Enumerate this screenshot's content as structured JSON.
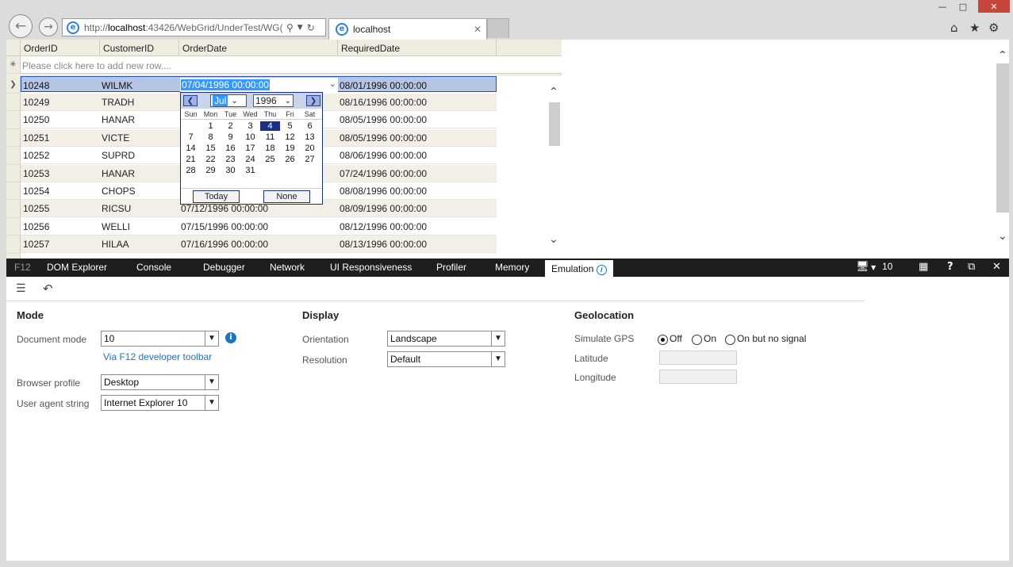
{
  "browser": {
    "url_prefix": "http://",
    "url_host": "localhost",
    "url_rest": ":43426/WebGrid/UnderTest/WG(",
    "tab_title": "localhost"
  },
  "grid": {
    "headers": [
      "OrderID",
      "CustomerID",
      "OrderDate",
      "RequiredDate"
    ],
    "new_row_placeholder": "Please click here to add new row....",
    "rows": [
      {
        "id": "10248",
        "customer": "WILMK",
        "order_date": "07/04/1996 00:00:00",
        "required": "08/01/1996 00:00:00"
      },
      {
        "id": "10249",
        "customer": "TRADH",
        "order_date": "",
        "required": "08/16/1996 00:00:00"
      },
      {
        "id": "10250",
        "customer": "HANAR",
        "order_date": "",
        "required": "08/05/1996 00:00:00"
      },
      {
        "id": "10251",
        "customer": "VICTE",
        "order_date": "",
        "required": "08/05/1996 00:00:00"
      },
      {
        "id": "10252",
        "customer": "SUPRD",
        "order_date": "",
        "required": "08/06/1996 00:00:00"
      },
      {
        "id": "10253",
        "customer": "HANAR",
        "order_date": "",
        "required": "07/24/1996 00:00:00"
      },
      {
        "id": "10254",
        "customer": "CHOPS",
        "order_date": "",
        "required": "08/08/1996 00:00:00"
      },
      {
        "id": "10255",
        "customer": "RICSU",
        "order_date": "07/12/1996 00:00:00",
        "required": "08/09/1996 00:00:00"
      },
      {
        "id": "10256",
        "customer": "WELLI",
        "order_date": "07/15/1996 00:00:00",
        "required": "08/12/1996 00:00:00"
      },
      {
        "id": "10257",
        "customer": "HILAA",
        "order_date": "07/16/1996 00:00:00",
        "required": "08/13/1996 00:00:00"
      }
    ]
  },
  "calendar": {
    "month": "Jul",
    "year": "1996",
    "weekdays": [
      "Sun",
      "Mon",
      "Tue",
      "Wed",
      "Thu",
      "Fri",
      "Sat"
    ],
    "days": [
      [
        "",
        "1",
        "2",
        "3",
        "4",
        "5",
        "6"
      ],
      [
        "7",
        "8",
        "9",
        "10",
        "11",
        "12",
        "13"
      ],
      [
        "14",
        "15",
        "16",
        "17",
        "18",
        "19",
        "20"
      ],
      [
        "21",
        "22",
        "23",
        "24",
        "25",
        "26",
        "27"
      ],
      [
        "28",
        "29",
        "30",
        "31",
        "",
        "",
        ""
      ]
    ],
    "selected_day": "4",
    "today_label": "Today",
    "none_label": "None"
  },
  "devtools": {
    "f12_label": "F12",
    "tabs": [
      "DOM Explorer",
      "Console",
      "Debugger",
      "Network",
      "UI Responsiveness",
      "Profiler",
      "Memory",
      "Emulation"
    ],
    "active_tab": "Emulation",
    "doc_mode_indicator": "10",
    "mode": {
      "title": "Mode",
      "document_mode_label": "Document mode",
      "document_mode_value": "10",
      "via_link": "Via F12 developer toolbar",
      "browser_profile_label": "Browser profile",
      "browser_profile_value": "Desktop",
      "user_agent_label": "User agent string",
      "user_agent_value": "Internet Explorer 10"
    },
    "display": {
      "title": "Display",
      "orientation_label": "Orientation",
      "orientation_value": "Landscape",
      "resolution_label": "Resolution",
      "resolution_value": "Default"
    },
    "geolocation": {
      "title": "Geolocation",
      "simulate_gps_label": "Simulate GPS",
      "options": [
        "Off",
        "On",
        "On but no signal"
      ],
      "selected": "Off",
      "latitude_label": "Latitude",
      "longitude_label": "Longitude"
    }
  },
  "colors": {
    "accent": "#1e73be",
    "selected_row": "#b4c6e4",
    "devtools_bar": "#1e1e1e",
    "close_button": "#c7463a"
  }
}
